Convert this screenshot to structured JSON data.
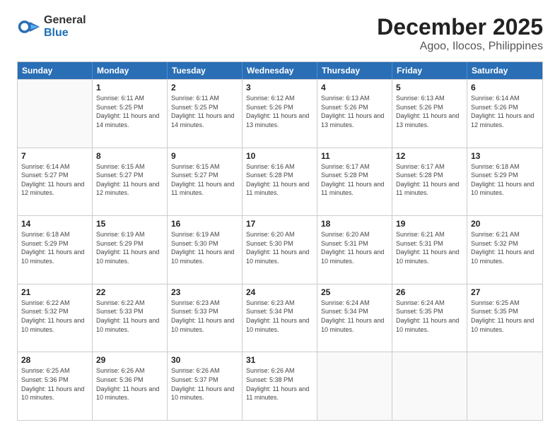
{
  "logo": {
    "general": "General",
    "blue": "Blue"
  },
  "title": "December 2025",
  "subtitle": "Agoo, Ilocos, Philippines",
  "days": [
    "Sunday",
    "Monday",
    "Tuesday",
    "Wednesday",
    "Thursday",
    "Friday",
    "Saturday"
  ],
  "rows": [
    [
      {
        "num": "",
        "empty": true
      },
      {
        "num": "1",
        "sunrise": "6:11 AM",
        "sunset": "5:25 PM",
        "daylight": "11 hours and 14 minutes."
      },
      {
        "num": "2",
        "sunrise": "6:11 AM",
        "sunset": "5:25 PM",
        "daylight": "11 hours and 14 minutes."
      },
      {
        "num": "3",
        "sunrise": "6:12 AM",
        "sunset": "5:26 PM",
        "daylight": "11 hours and 13 minutes."
      },
      {
        "num": "4",
        "sunrise": "6:13 AM",
        "sunset": "5:26 PM",
        "daylight": "11 hours and 13 minutes."
      },
      {
        "num": "5",
        "sunrise": "6:13 AM",
        "sunset": "5:26 PM",
        "daylight": "11 hours and 13 minutes."
      },
      {
        "num": "6",
        "sunrise": "6:14 AM",
        "sunset": "5:26 PM",
        "daylight": "11 hours and 12 minutes."
      }
    ],
    [
      {
        "num": "7",
        "sunrise": "6:14 AM",
        "sunset": "5:27 PM",
        "daylight": "11 hours and 12 minutes."
      },
      {
        "num": "8",
        "sunrise": "6:15 AM",
        "sunset": "5:27 PM",
        "daylight": "11 hours and 12 minutes."
      },
      {
        "num": "9",
        "sunrise": "6:15 AM",
        "sunset": "5:27 PM",
        "daylight": "11 hours and 11 minutes."
      },
      {
        "num": "10",
        "sunrise": "6:16 AM",
        "sunset": "5:28 PM",
        "daylight": "11 hours and 11 minutes."
      },
      {
        "num": "11",
        "sunrise": "6:17 AM",
        "sunset": "5:28 PM",
        "daylight": "11 hours and 11 minutes."
      },
      {
        "num": "12",
        "sunrise": "6:17 AM",
        "sunset": "5:28 PM",
        "daylight": "11 hours and 11 minutes."
      },
      {
        "num": "13",
        "sunrise": "6:18 AM",
        "sunset": "5:29 PM",
        "daylight": "11 hours and 10 minutes."
      }
    ],
    [
      {
        "num": "14",
        "sunrise": "6:18 AM",
        "sunset": "5:29 PM",
        "daylight": "11 hours and 10 minutes."
      },
      {
        "num": "15",
        "sunrise": "6:19 AM",
        "sunset": "5:29 PM",
        "daylight": "11 hours and 10 minutes."
      },
      {
        "num": "16",
        "sunrise": "6:19 AM",
        "sunset": "5:30 PM",
        "daylight": "11 hours and 10 minutes."
      },
      {
        "num": "17",
        "sunrise": "6:20 AM",
        "sunset": "5:30 PM",
        "daylight": "11 hours and 10 minutes."
      },
      {
        "num": "18",
        "sunrise": "6:20 AM",
        "sunset": "5:31 PM",
        "daylight": "11 hours and 10 minutes."
      },
      {
        "num": "19",
        "sunrise": "6:21 AM",
        "sunset": "5:31 PM",
        "daylight": "11 hours and 10 minutes."
      },
      {
        "num": "20",
        "sunrise": "6:21 AM",
        "sunset": "5:32 PM",
        "daylight": "11 hours and 10 minutes."
      }
    ],
    [
      {
        "num": "21",
        "sunrise": "6:22 AM",
        "sunset": "5:32 PM",
        "daylight": "11 hours and 10 minutes."
      },
      {
        "num": "22",
        "sunrise": "6:22 AM",
        "sunset": "5:33 PM",
        "daylight": "11 hours and 10 minutes."
      },
      {
        "num": "23",
        "sunrise": "6:23 AM",
        "sunset": "5:33 PM",
        "daylight": "11 hours and 10 minutes."
      },
      {
        "num": "24",
        "sunrise": "6:23 AM",
        "sunset": "5:34 PM",
        "daylight": "11 hours and 10 minutes."
      },
      {
        "num": "25",
        "sunrise": "6:24 AM",
        "sunset": "5:34 PM",
        "daylight": "11 hours and 10 minutes."
      },
      {
        "num": "26",
        "sunrise": "6:24 AM",
        "sunset": "5:35 PM",
        "daylight": "11 hours and 10 minutes."
      },
      {
        "num": "27",
        "sunrise": "6:25 AM",
        "sunset": "5:35 PM",
        "daylight": "11 hours and 10 minutes."
      }
    ],
    [
      {
        "num": "28",
        "sunrise": "6:25 AM",
        "sunset": "5:36 PM",
        "daylight": "11 hours and 10 minutes."
      },
      {
        "num": "29",
        "sunrise": "6:26 AM",
        "sunset": "5:36 PM",
        "daylight": "11 hours and 10 minutes."
      },
      {
        "num": "30",
        "sunrise": "6:26 AM",
        "sunset": "5:37 PM",
        "daylight": "11 hours and 10 minutes."
      },
      {
        "num": "31",
        "sunrise": "6:26 AM",
        "sunset": "5:38 PM",
        "daylight": "11 hours and 11 minutes."
      },
      {
        "num": "",
        "empty": true
      },
      {
        "num": "",
        "empty": true
      },
      {
        "num": "",
        "empty": true
      }
    ]
  ]
}
